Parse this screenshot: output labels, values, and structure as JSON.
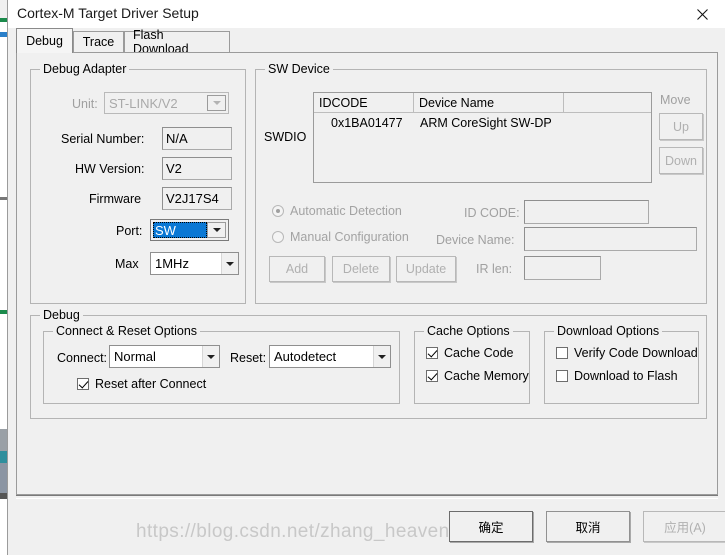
{
  "window": {
    "title": "Cortex-M Target Driver Setup",
    "close_icon": "close-icon"
  },
  "tabs": [
    {
      "label": "Debug",
      "active": true
    },
    {
      "label": "Trace",
      "active": false
    },
    {
      "label": "Flash Download",
      "active": false
    }
  ],
  "debug_adapter": {
    "group_label": "Debug Adapter",
    "unit": {
      "label": "Unit:",
      "value": "ST-LINK/V2",
      "disabled": true
    },
    "serial_number": {
      "label": "Serial Number:",
      "value": "N/A"
    },
    "hw_version": {
      "label": "HW Version:",
      "value": "V2"
    },
    "firmware": {
      "label": "Firmware",
      "value": "V2J17S4"
    },
    "port": {
      "label": "Port:",
      "value": "SW",
      "focused": true
    },
    "max": {
      "label": "Max",
      "value": "1MHz"
    }
  },
  "sw_device": {
    "group_label": "SW Device",
    "signal_label": "SWDIO",
    "columns": [
      "IDCODE",
      "Device Name",
      ""
    ],
    "rows": [
      {
        "idcode": "0x1BA01477",
        "device_name": "ARM CoreSight SW-DP",
        "extra": ""
      }
    ],
    "move": {
      "label": "Move",
      "up_label": "Up",
      "down_label": "Down"
    },
    "detection": {
      "automatic_label": "Automatic Detection",
      "automatic_selected": true,
      "manual_label": "Manual Configuration",
      "manual_selected": false
    },
    "id_code": {
      "label": "ID CODE:",
      "value": ""
    },
    "device_name": {
      "label": "Device Name:",
      "value": ""
    },
    "ir_len": {
      "label": "IR len:",
      "value": ""
    },
    "buttons": {
      "add": "Add",
      "delete": "Delete",
      "update": "Update"
    }
  },
  "debug": {
    "group_label": "Debug",
    "connect_reset": {
      "group_label": "Connect & Reset Options",
      "connect": {
        "label": "Connect:",
        "value": "Normal"
      },
      "reset": {
        "label": "Reset:",
        "value": "Autodetect"
      },
      "reset_after_connect": {
        "label": "Reset after Connect",
        "checked": true
      }
    },
    "cache_options": {
      "group_label": "Cache Options",
      "cache_code": {
        "label": "Cache Code",
        "checked": true
      },
      "cache_memory": {
        "label": "Cache Memory",
        "checked": true
      }
    },
    "download_options": {
      "group_label": "Download Options",
      "verify_code_download": {
        "label": "Verify Code Download",
        "checked": false
      },
      "download_to_flash": {
        "label": "Download to Flash",
        "checked": false
      }
    }
  },
  "footer": {
    "ok_label": "确定",
    "cancel_label": "取消",
    "apply_label": "应用(A)",
    "apply_disabled": true
  },
  "watermark": {
    "text": "https://blog.csdn.net/zhang_heaven"
  },
  "colors": {
    "accent_selection": "#0a78d4",
    "dialog_bg": "#f0f0f0",
    "border": "#9b9b9b",
    "disabled_text": "#a9a9a9"
  }
}
